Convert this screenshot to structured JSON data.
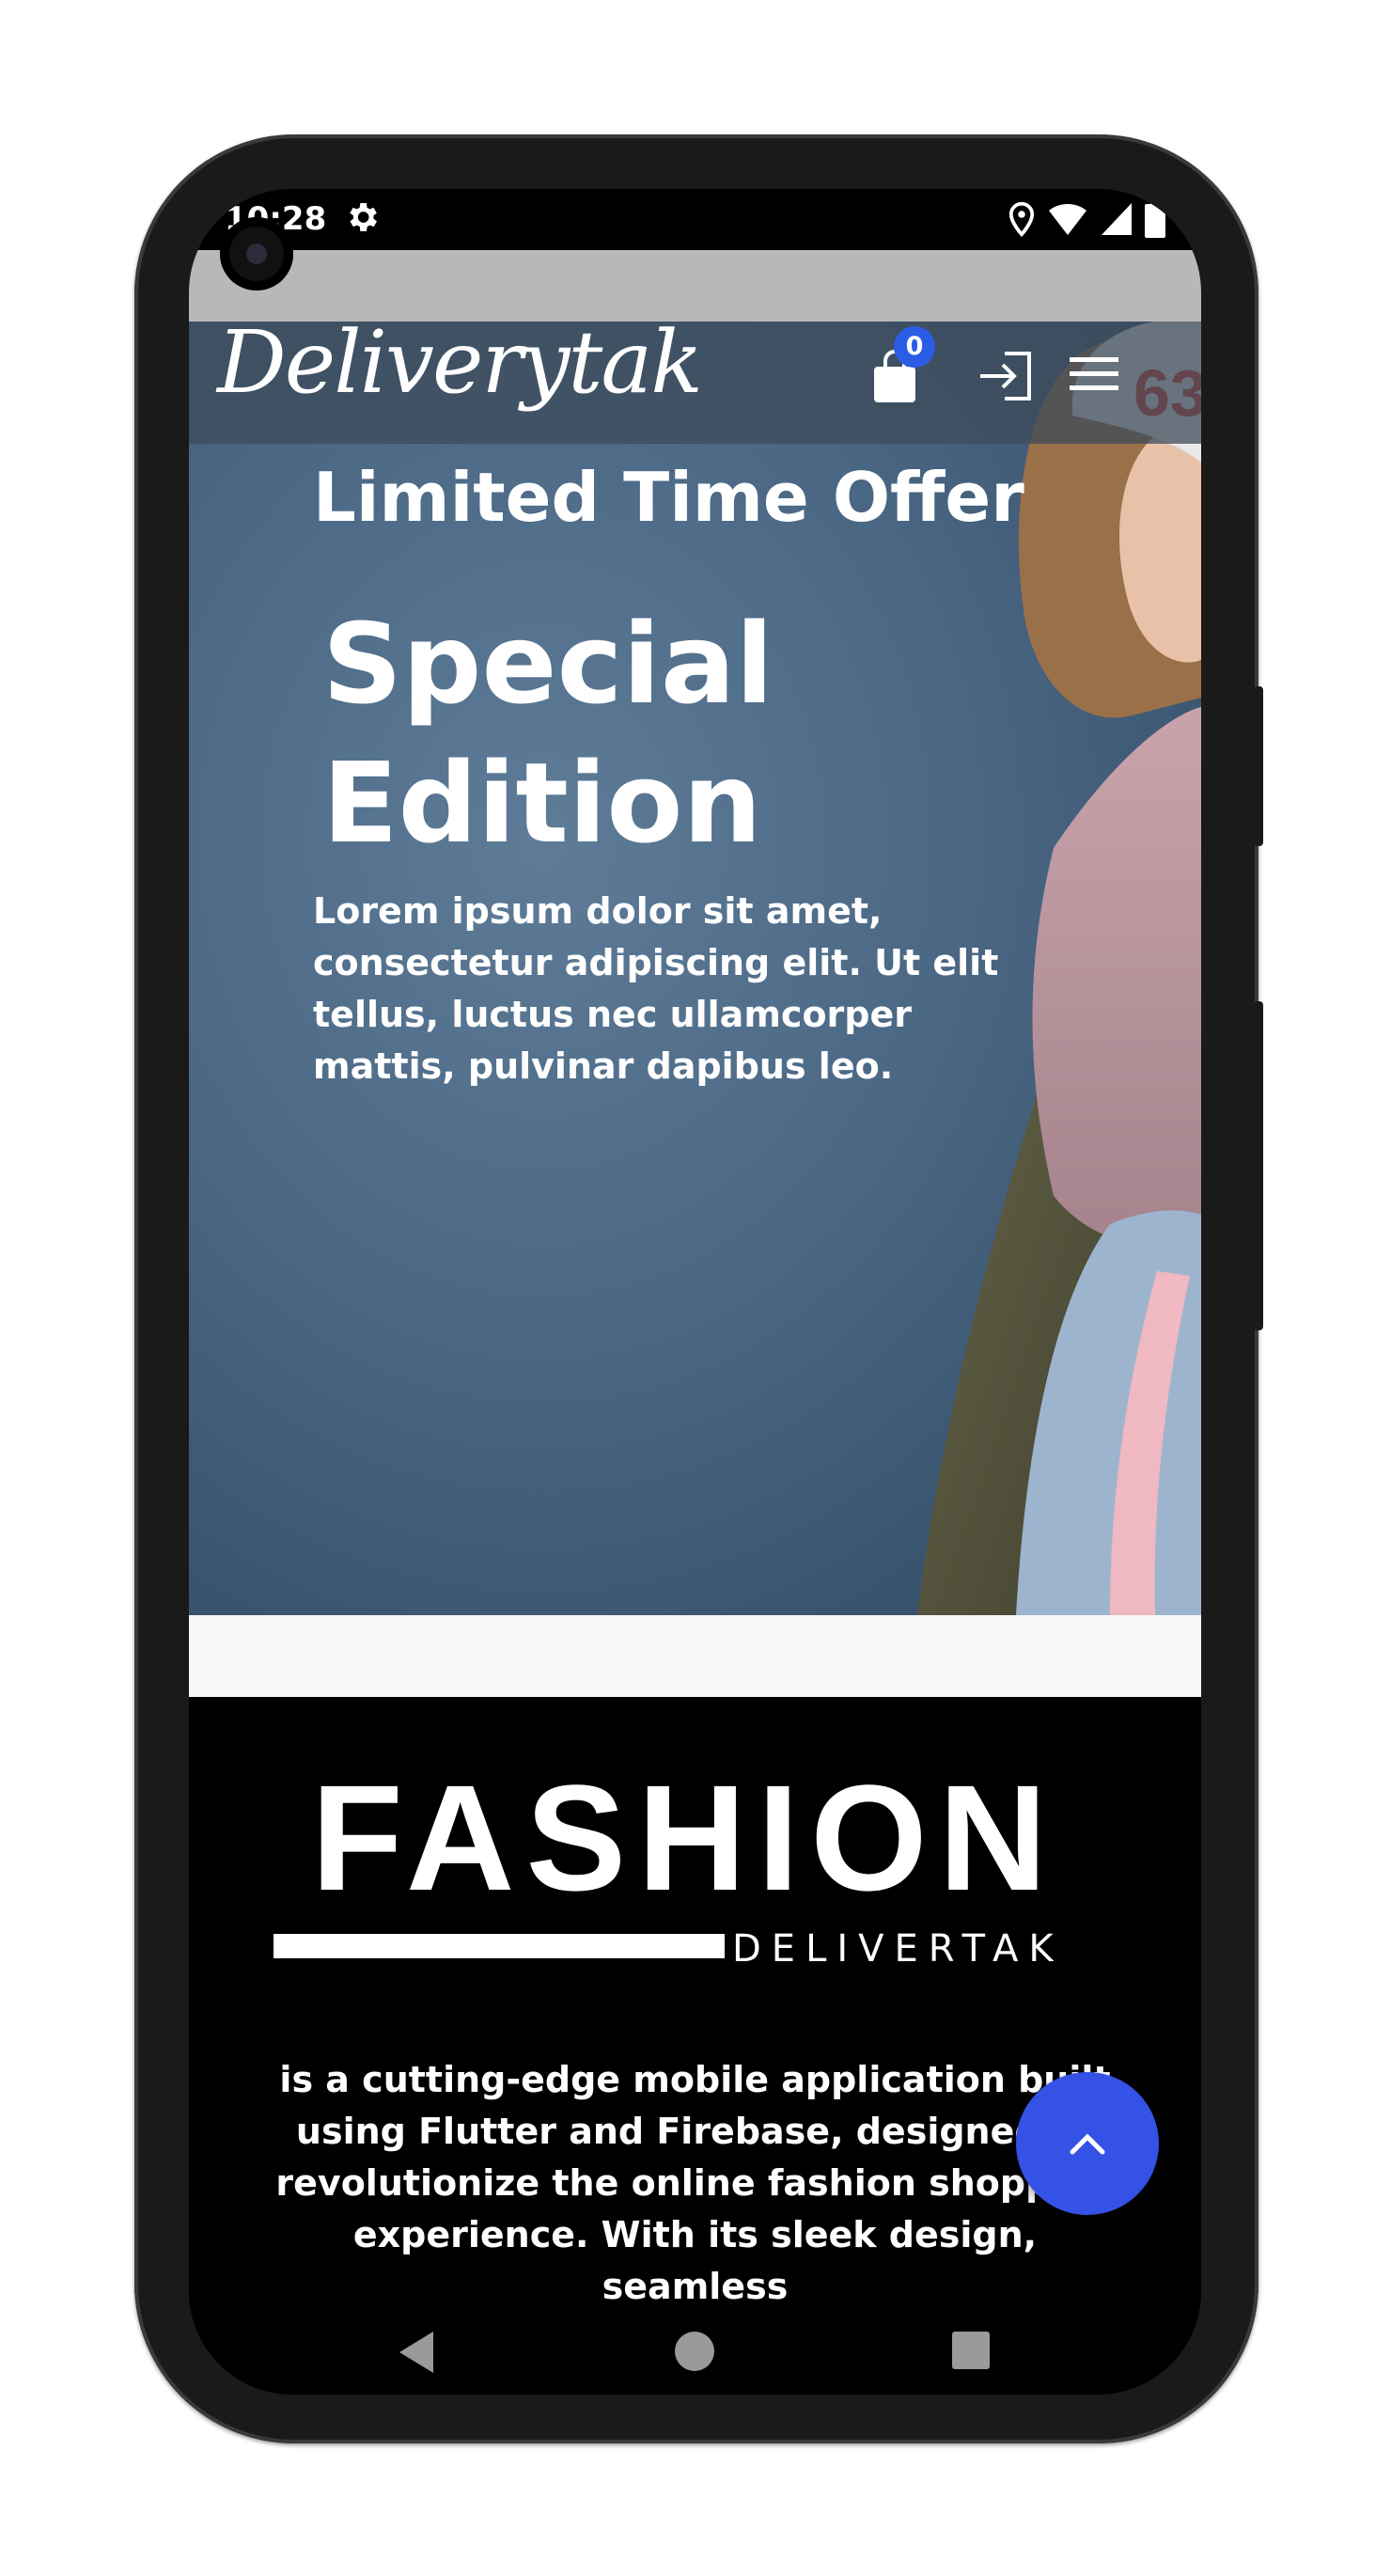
{
  "status_bar": {
    "time": "10:28",
    "icons": [
      "gear-icon",
      "location-icon",
      "wifi-icon",
      "signal-icon",
      "battery-icon"
    ]
  },
  "header": {
    "logo": "Deliverytak",
    "cart_count": "0",
    "icons": [
      "shopping-bag-icon",
      "login-icon",
      "hamburger-menu-icon"
    ]
  },
  "hero": {
    "kicker": "Limited Time Offer",
    "title_line1": "Special",
    "title_line2": "Edition",
    "body": "Lorem ipsum dolor sit amet, consectetur adipiscing elit. Ut elit tellus, luctus nec ullamcorper mattis, pulvinar dapibus leo."
  },
  "brand": {
    "wordmark": "FASHION",
    "subword": "DELIVERTAK",
    "description": "is a cutting-edge mobile application built using Flutter and Firebase, designed to revolutionize the online fashion shopping experience. With its sleek design, seamless"
  },
  "fab": {
    "icon": "chevron-up-icon"
  },
  "system_nav": {
    "icons": [
      "back-icon",
      "home-icon",
      "recents-icon"
    ]
  },
  "colors": {
    "accent": "#3552e6",
    "badge": "#2b5ce6",
    "hero_bg": "#4a6784"
  }
}
